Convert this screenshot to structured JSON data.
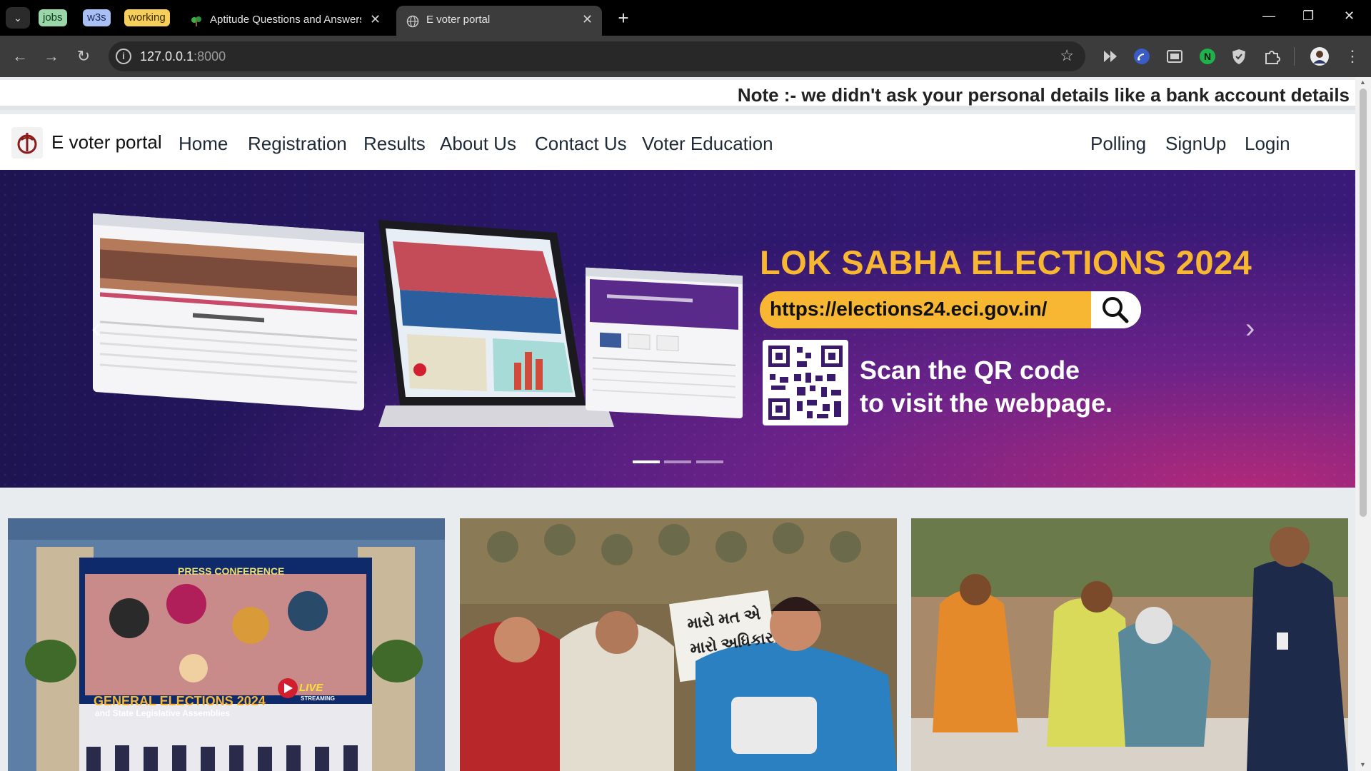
{
  "browser": {
    "tab_groups": [
      {
        "label": "jobs",
        "bg": "#9ad6a8",
        "fg": "#0d3b1e"
      },
      {
        "label": "w3s",
        "bg": "#a9c0f5",
        "fg": "#1a2a55"
      },
      {
        "label": "working",
        "bg": "#f6cf5a",
        "fg": "#3a2a00"
      }
    ],
    "tabs": [
      {
        "title": "Aptitude Questions and Answers",
        "active": false
      },
      {
        "title": "E voter portal",
        "active": true
      }
    ],
    "address_host": "127.0.0.1",
    "address_port": ":8000"
  },
  "page": {
    "note": "Note :- we didn't ask your personal details like a bank account details",
    "brand": "E voter portal",
    "nav_left": [
      "Home",
      "Registration",
      "Results",
      "About Us",
      "Contact Us",
      "Voter Education"
    ],
    "nav_right": [
      "Polling",
      "SignUp",
      "Login"
    ],
    "carousel": {
      "headline": "LOK SABHA ELECTIONS 2024",
      "url": "https://elections24.eci.gov.in/",
      "scan_line1": "Scan the QR code",
      "scan_line2": "to visit the webpage.",
      "slides": 3,
      "active_slide": 1
    },
    "cards": {
      "press": {
        "title": "PRESS CONFERENCE",
        "election": "GENERAL ELECTIONS 2024",
        "subtitle": "and State Legislative Assemblies",
        "live": "LIVE",
        "streaming": "STREAMING"
      },
      "placard": {
        "line1": "મારો મત એ",
        "line2": "મારો અધિકાર"
      }
    }
  },
  "colors": {
    "accent_yellow": "#f7b733",
    "banner_purple": "#2b176a"
  }
}
